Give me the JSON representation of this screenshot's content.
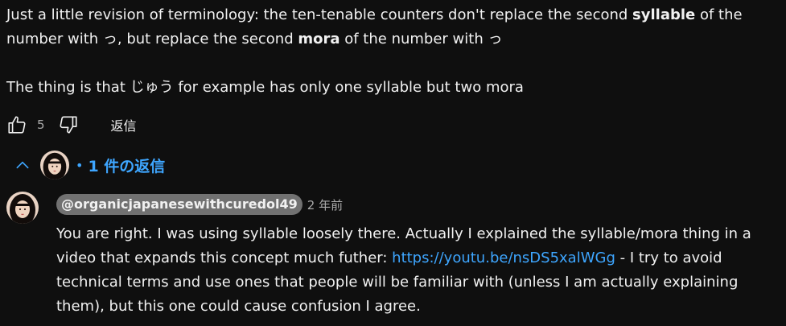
{
  "comment": {
    "text_part1": "Just a little revision of terminology: the ten-tenable counters don't replace the second ",
    "bold1": "syllable",
    "text_part2": " of the number with っ, but replace the second ",
    "bold2": "mora",
    "text_part3": " of the number with っ",
    "text_line2": "The thing is that じゅう for example has only one syllable but two mora",
    "like_count": "5",
    "reply_label": "返信"
  },
  "replies_toggle": {
    "dot": "•",
    "label": "1 件の返信"
  },
  "reply": {
    "author": "@organicjapanesewithcuredol49",
    "timestamp": "2 年前",
    "text_part1": "You are right. I was using syllable loosely there. Actually I explained the syllable/mora thing in a video that expands this concept much futher: ",
    "link": "https://youtu.be/nsDS5xalWGg",
    "text_part2": " - I try to avoid technical terms and use ones that people will be familiar with (unless I am actually explaining them), but this one could cause confusion I agree."
  },
  "colors": {
    "background": "#0f0f0f",
    "text": "#f1f1f1",
    "secondary": "#aaaaaa",
    "link": "#3ea6ff",
    "author_chip": "#717171"
  },
  "icons": {
    "like": "thumbs-up-icon",
    "dislike": "thumbs-down-icon",
    "collapse": "chevron-up-icon"
  }
}
